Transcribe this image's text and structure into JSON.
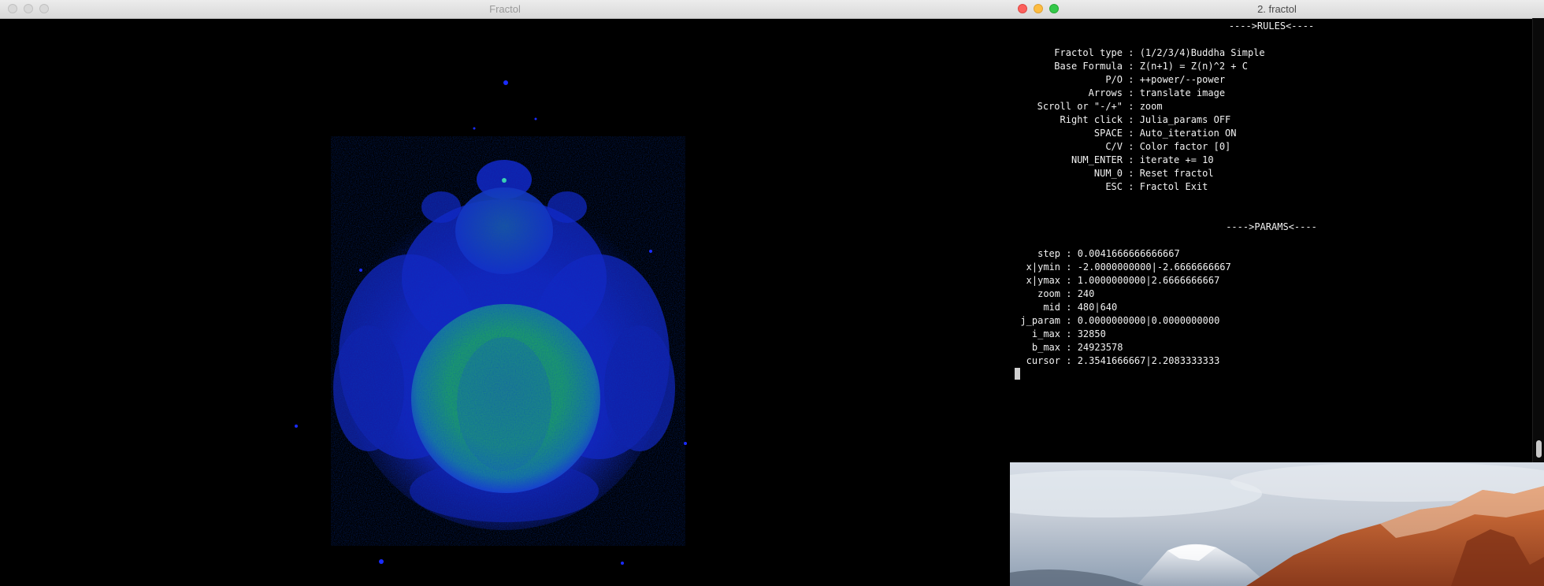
{
  "fractol_window": {
    "title": "Fractol",
    "image_alt": "Buddhabrot fractal rendering (blue/green)"
  },
  "terminal_window": {
    "title": "2. fractol",
    "rules_header": "---->RULES<----",
    "rules": [
      {
        "label": "Fractol type",
        "value": "(1/2/3/4)Buddha Simple"
      },
      {
        "label": "Base Formula",
        "value": "Z(n+1) = Z(n)^2 + C"
      },
      {
        "label": "P/O",
        "value": "++power/--power"
      },
      {
        "label": "Arrows",
        "value": "translate image"
      },
      {
        "label": "Scroll or \"-/+\"",
        "value": "zoom"
      },
      {
        "label": "Right click",
        "value": "Julia_params OFF"
      },
      {
        "label": "SPACE",
        "value": "Auto_iteration ON"
      },
      {
        "label": "C/V",
        "value": "Color factor [0]"
      },
      {
        "label": "NUM_ENTER",
        "value": "iterate += 10"
      },
      {
        "label": "NUM_0",
        "value": "Reset fractol"
      },
      {
        "label": "ESC",
        "value": "Fractol Exit"
      }
    ],
    "params_header": "---->PARAMS<----",
    "params": [
      {
        "label": "step",
        "value": "0.0041666666666667"
      },
      {
        "label": "x|ymin",
        "value": "-2.0000000000|-2.6666666667"
      },
      {
        "label": "x|ymax",
        "value": "1.0000000000|2.6666666667"
      },
      {
        "label": "zoom",
        "value": "240"
      },
      {
        "label": "mid",
        "value": "480|640"
      },
      {
        "label": "j_param",
        "value": "0.0000000000|0.0000000000"
      },
      {
        "label": "i_max",
        "value": "32850"
      },
      {
        "label": "b_max",
        "value": "24923578"
      },
      {
        "label": "cursor",
        "value": "2.3541666667|2.2083333333"
      }
    ],
    "separator": " : "
  },
  "colors": {
    "fractal_blue": "#1a2cff",
    "fractal_green": "#1faa6a",
    "terminal_bg": "#000000",
    "terminal_fg": "#f2f2f2"
  }
}
